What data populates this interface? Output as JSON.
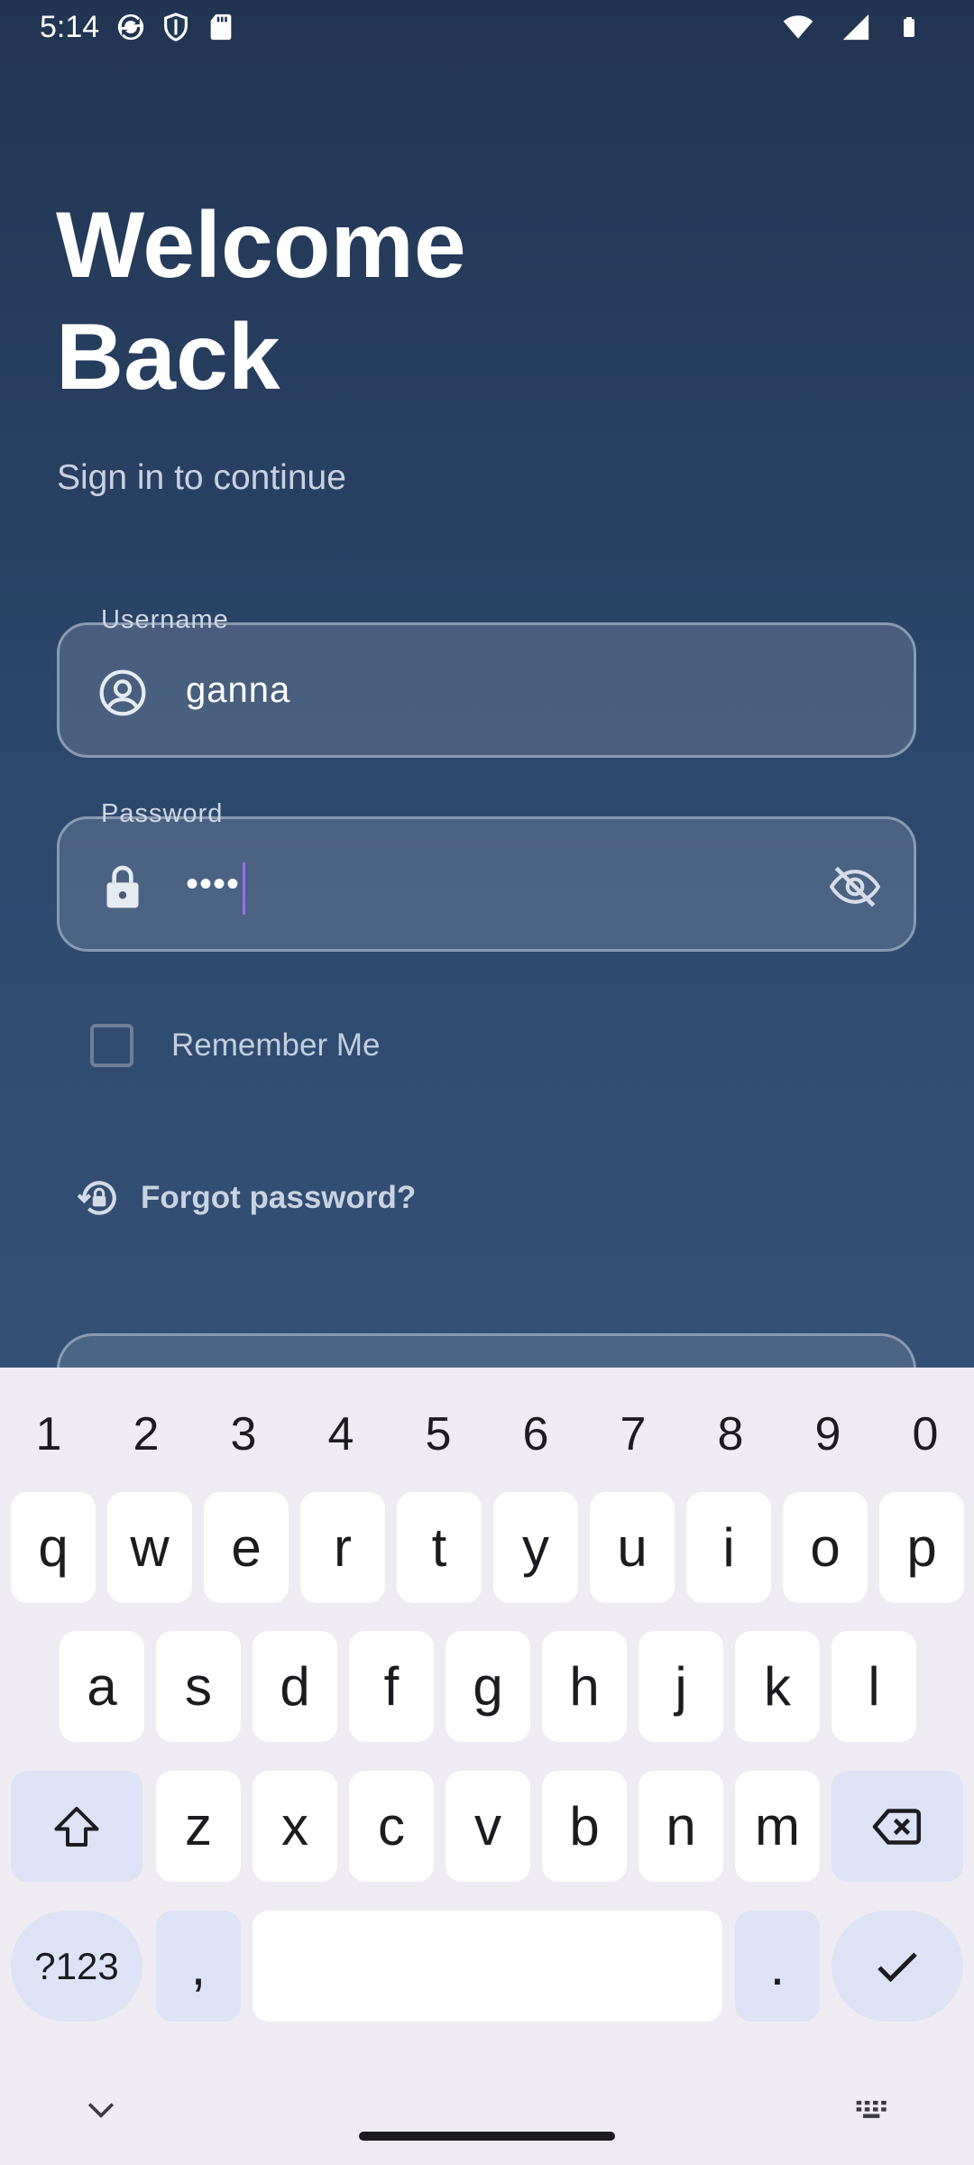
{
  "status_bar": {
    "time": "5:14",
    "left_icons": [
      "sync-icon",
      "shield-icon",
      "sd-card-icon"
    ],
    "right_icons": [
      "wifi-icon",
      "signal-icon",
      "battery-icon"
    ]
  },
  "header": {
    "title_line1": "Welcome",
    "title_line2": "Back",
    "subtitle": "Sign in to continue"
  },
  "form": {
    "username": {
      "label": "Username",
      "value": "ganna",
      "icon": "account-circle-icon"
    },
    "password": {
      "label": "Password",
      "value": "••••",
      "icon": "lock-icon",
      "toggle_icon": "eye-off-icon"
    },
    "remember_me": {
      "label": "Remember Me",
      "checked": false
    },
    "forgot_password": {
      "label": "Forgot password?",
      "icon": "lock-reset-icon"
    }
  },
  "keyboard": {
    "number_row": [
      "1",
      "2",
      "3",
      "4",
      "5",
      "6",
      "7",
      "8",
      "9",
      "0"
    ],
    "row1": [
      "q",
      "w",
      "e",
      "r",
      "t",
      "y",
      "u",
      "i",
      "o",
      "p"
    ],
    "row2": [
      "a",
      "s",
      "d",
      "f",
      "g",
      "h",
      "j",
      "k",
      "l"
    ],
    "row3": [
      "z",
      "x",
      "c",
      "v",
      "b",
      "n",
      "m"
    ],
    "symbols_label": "?123",
    "comma_label": ",",
    "period_label": "."
  },
  "colors": {
    "bg_top": "#213552",
    "bg_bottom": "#3d5a7d",
    "caret": "#9a6cf0",
    "keyboard_bg": "#eeecf2",
    "mod_key": "#dde2f6"
  }
}
